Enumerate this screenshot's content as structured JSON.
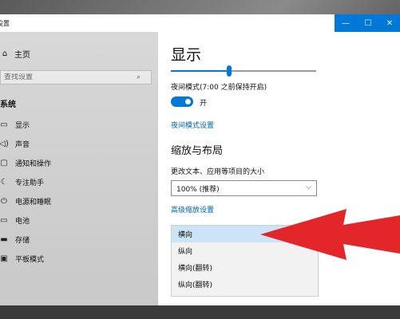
{
  "window": {
    "title": "设置",
    "controls": {
      "minimize": "—",
      "maximize": "☐",
      "close": "✕"
    }
  },
  "nav": {
    "home": {
      "label": "主页",
      "icon": "home-icon"
    },
    "search_placeholder": "查找设置",
    "group_title": "系统",
    "items": [
      {
        "label": "显示",
        "icon": "monitor-icon"
      },
      {
        "label": "声音",
        "icon": "speaker-icon"
      },
      {
        "label": "通知和操作",
        "icon": "notification-icon"
      },
      {
        "label": "专注助手",
        "icon": "moon-icon"
      },
      {
        "label": "电源和睡眠",
        "icon": "power-icon"
      },
      {
        "label": "电池",
        "icon": "battery-icon"
      },
      {
        "label": "存储",
        "icon": "storage-icon"
      },
      {
        "label": "平板模式",
        "icon": "tablet-icon"
      }
    ]
  },
  "content": {
    "title": "显示",
    "brightness_fraction": 0.4,
    "night_light_label": "夜间模式(7:00 之前保持开启)",
    "toggle_state_label": "开",
    "night_light_settings_link": "夜间模式设置",
    "scale_layout_title": "缩放与布局",
    "scale_label": "更改文本、应用等项目的大小",
    "scale_value": "100% (推荐)",
    "advanced_scaling_link": "高级缩放设置",
    "orientation_options": [
      "横向",
      "纵向",
      "横向(翻转)",
      "纵向(翻转)"
    ],
    "orientation_selected": "横向"
  },
  "colors": {
    "accent": "#0078d7",
    "link": "#0063b1",
    "dropdown_highlight": "#cce4f7",
    "arrow": "#e3262a"
  }
}
